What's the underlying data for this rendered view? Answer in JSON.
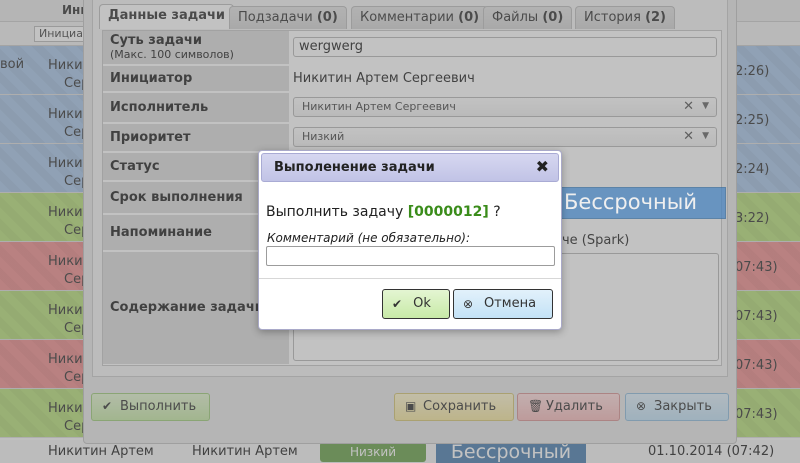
{
  "background": {
    "header": {
      "col_initiator": "Иници"
    },
    "filter": {
      "col_initiator": "Инициа"
    },
    "rows": [
      {
        "c0": "вой",
        "c1a": "Никит",
        "c1b": "Серг",
        "time": "2:26)"
      },
      {
        "c0": "",
        "c1a": "Никит",
        "c1b": "Серг",
        "time": "2:25)"
      },
      {
        "c0": "",
        "c1a": "Никит",
        "c1b": "Серг",
        "time": "2:24)"
      },
      {
        "c0": "",
        "c1a": "Никит",
        "c1b": "Серг",
        "time": "3:22)"
      },
      {
        "c0": "",
        "c1a": "Никит",
        "c1b": "Серг",
        "time": "07:43)"
      },
      {
        "c0": "",
        "c1a": "Никит",
        "c1b": "Серг",
        "time": "07:43)"
      },
      {
        "c0": "",
        "c1a": "Никит",
        "c1b": "Серг",
        "time": "07:43)"
      },
      {
        "c0": "",
        "c1a": "Никит",
        "c1b": "Серг",
        "time": "07:43)"
      }
    ],
    "bottom_row": {
      "col1": "Никитин Артем",
      "col2": "Никитин Артем",
      "priority": "Низкий",
      "deadline": "Бессрочный",
      "date": "01.10.2014 (07:42)"
    }
  },
  "task_dialog": {
    "tabs": [
      {
        "label": "Данные задачи",
        "count": ""
      },
      {
        "label": "Подзадачи",
        "count": "(0)"
      },
      {
        "label": "Комментарии",
        "count": "(0)"
      },
      {
        "label": "Файлы",
        "count": "(0)"
      },
      {
        "label": "История",
        "count": "(2)"
      }
    ],
    "fields": {
      "essence_label": "Суть задачи",
      "essence_hint": "(Макс. 100 символов)",
      "essence_value": "wergwerg",
      "initiator_label": "Инициатор",
      "initiator_value": "Никитин Артем Сергеевич",
      "executor_label": "Исполнитель",
      "executor_value": "Никитин Артем Сергеевич",
      "priority_label": "Приоритет",
      "priority_value": "Низкий",
      "status_label": "Статус",
      "deadline_label": "Срок выполнения",
      "deadline_value": "Бессрочный",
      "reminder_label": "Напоминание",
      "reminder_value": "че (Spark)",
      "content_label": "Содержание задачи"
    },
    "buttons": {
      "execute": "Выполнить",
      "save": "Сохранить",
      "delete": "Удалить",
      "close": "Закрыть"
    }
  },
  "confirm_modal": {
    "title": "Выполенение задачи",
    "close_glyph": "✖",
    "question_prefix": "Выполнить задачу",
    "task_number": "[0000012]",
    "question_suffix": "?",
    "comment_label": "Комментарий (не обязательно):",
    "comment_value": "",
    "ok_label": "Ok",
    "cancel_label": "Отмена"
  },
  "colors": {
    "row_blue": "#a9c6e8",
    "row_green": "#b9e07a",
    "row_red": "#f08f8f",
    "task_number": "#3a8c1a",
    "deadline_badge": "#4b85c0"
  }
}
